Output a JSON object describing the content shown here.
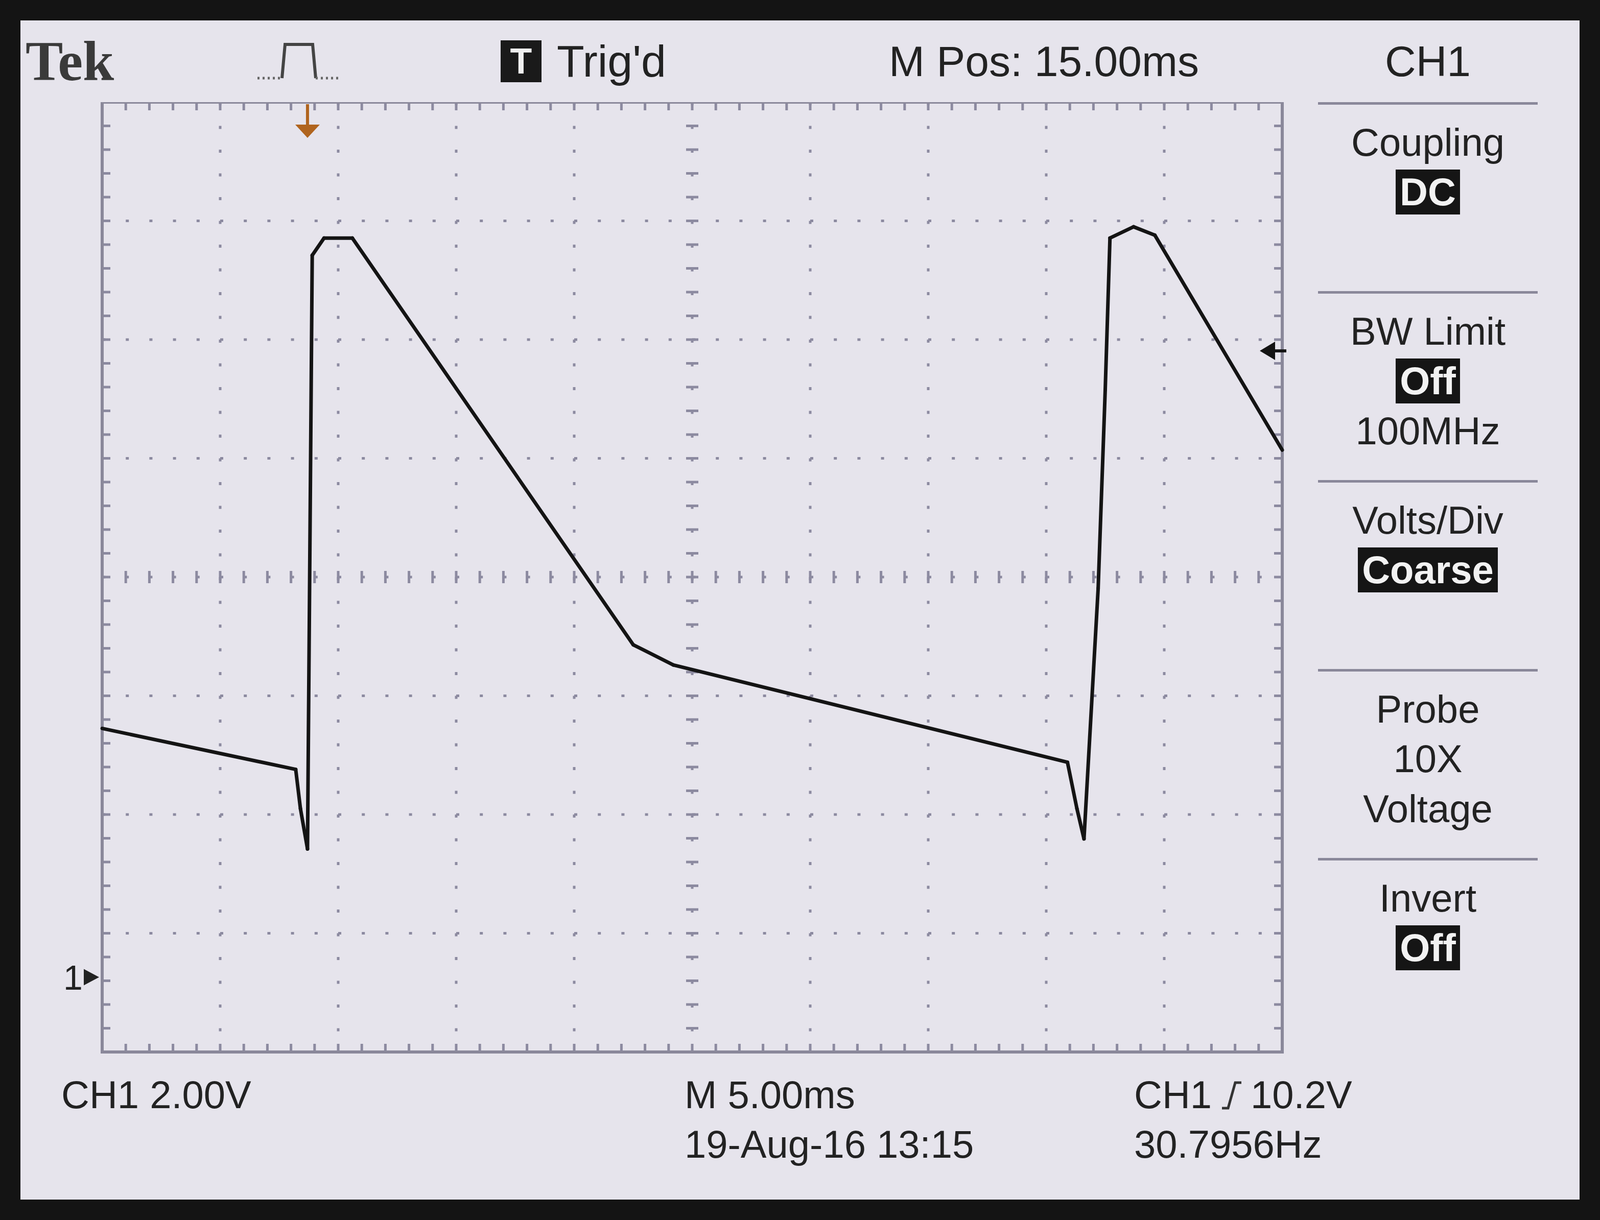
{
  "brand": {
    "text": "Tek"
  },
  "top_bar": {
    "trigger_status_badge": "T",
    "trigger_status": "Trig'd",
    "main_position": "M Pos: 15.00ms",
    "menu_title": "CH1"
  },
  "menu": [
    {
      "label": "Coupling",
      "values": [
        {
          "text": "DC",
          "selected": true
        }
      ]
    },
    {
      "label": "BW Limit",
      "values": [
        {
          "text": "Off",
          "selected": true
        },
        {
          "text": "100MHz",
          "selected": false
        }
      ]
    },
    {
      "label": "Volts/Div",
      "values": [
        {
          "text": "Coarse",
          "selected": true
        }
      ]
    },
    {
      "label": "Probe",
      "values": [
        {
          "text": "10X",
          "selected": false
        },
        {
          "text": "Voltage",
          "selected": false
        }
      ]
    },
    {
      "label": "Invert",
      "values": [
        {
          "text": "Off",
          "selected": true
        }
      ]
    }
  ],
  "status_bar": {
    "channel_scale": "CH1 2.00V",
    "timebase": "M 5.00ms",
    "trigger_source": "CH1",
    "trigger_rising": true,
    "trigger_level": "10.2V",
    "datetime": "19-Aug-16 13:15",
    "frequency": "30.7956Hz"
  },
  "chart": {
    "channel_marker": "1",
    "volts_per_div": 2,
    "ms_per_div": 5,
    "divisions_x": 10,
    "divisions_y": 8,
    "ground_div_from_bottom": 0.63,
    "trigger_time_ms": 8.7,
    "trigger_level_volts": 10.55,
    "series": [
      {
        "name": "CH1",
        "times_ms": [
          0,
          8.2,
          8.4,
          8.7,
          8.9,
          9.4,
          10.6,
          22.5,
          24.2,
          40.9,
          41.3,
          41.6,
          42.2,
          42.5,
          42.7,
          43.7,
          44.6,
          50
        ],
        "volts": [
          4.19,
          3.5,
          2.84,
          2.16,
          12.16,
          12.45,
          12.45,
          5.6,
          5.26,
          3.62,
          2.84,
          2.33,
          6.55,
          9.9,
          12.45,
          12.64,
          12.5,
          8.88
        ]
      }
    ]
  }
}
